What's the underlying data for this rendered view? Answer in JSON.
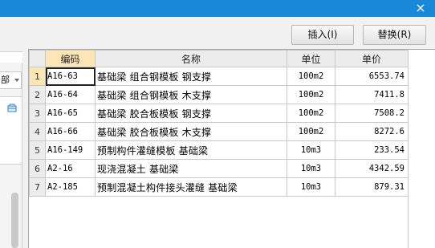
{
  "window": {
    "close_glyph": "×"
  },
  "left_panel": {
    "combo_text": "部",
    "package_icon": "package-icon"
  },
  "buttons": {
    "insert_label": "插入(I)",
    "replace_label": "替换(R)"
  },
  "table": {
    "columns": [
      "",
      "编码",
      "名称",
      "单位",
      "单价"
    ],
    "rows": [
      {
        "num": "1",
        "code": "A16-63",
        "name": "基础梁 组合钢模板 钢支撑",
        "unit": "100m2",
        "price": "6553.74"
      },
      {
        "num": "2",
        "code": "A16-64",
        "name": "基础梁 组合钢模板 木支撑",
        "unit": "100m2",
        "price": "7411.8"
      },
      {
        "num": "3",
        "code": "A16-65",
        "name": "基础梁 胶合板模板 钢支撑",
        "unit": "100m2",
        "price": "7508.2"
      },
      {
        "num": "4",
        "code": "A16-66",
        "name": "基础梁 胶合板模板 木支撑",
        "unit": "100m2",
        "price": "8272.6"
      },
      {
        "num": "5",
        "code": "A16-149",
        "name": "预制构件灌缝模板 基础梁",
        "unit": "10m3",
        "price": "233.54"
      },
      {
        "num": "6",
        "code": "A2-16",
        "name": "现浇混凝土 基础梁",
        "unit": "10m3",
        "price": "4342.59"
      },
      {
        "num": "7",
        "code": "A2-185",
        "name": "预制混凝土构件接头灌缝 基础梁",
        "unit": "10m3",
        "price": "879.31"
      }
    ]
  }
}
